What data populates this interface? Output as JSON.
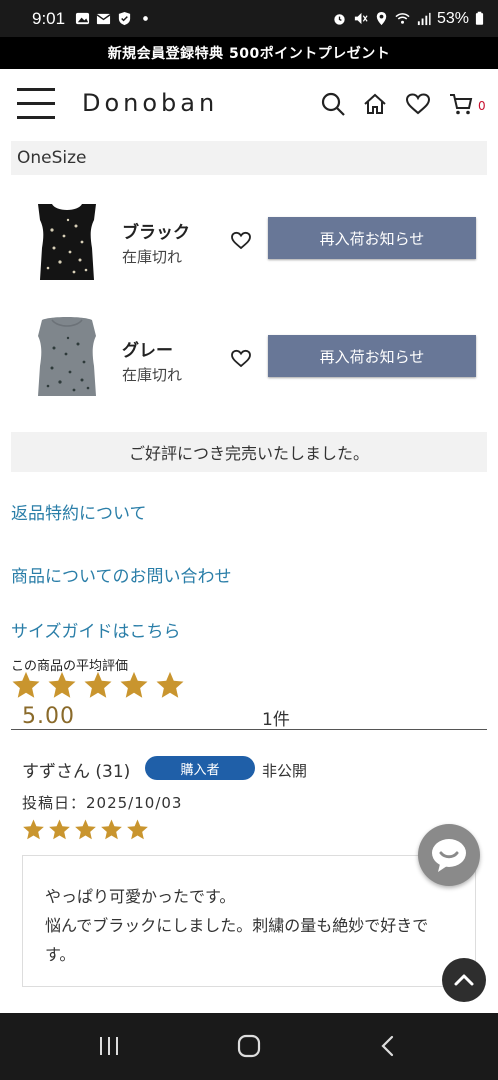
{
  "status_bar": {
    "time": "9:01",
    "battery": "53%"
  },
  "promo_banner": "新規会員登録特典 500ポイントプレゼント",
  "header": {
    "logo": "Donoban",
    "cart_count": "0"
  },
  "size_label": "OneSize",
  "variants": [
    {
      "color": "ブラック",
      "stock": "在庫切れ",
      "button": "再入荷お知らせ"
    },
    {
      "color": "グレー",
      "stock": "在庫切れ",
      "button": "再入荷お知らせ"
    }
  ],
  "sold_out_notice": "ご好評につき完売いたしました。",
  "links": {
    "returns": "返品特約について",
    "inquiry": "商品についてのお問い合わせ",
    "size_guide": "サイズガイドはこちら"
  },
  "rating": {
    "label": "この商品の平均評価",
    "average": "5.00",
    "stars": 5,
    "count": "1件"
  },
  "review": {
    "reviewer": "すずさん (31)",
    "badge": "購入者",
    "visibility": "非公開",
    "date": "投稿日：2025/10/03",
    "stars": 5,
    "text_line1": "やっぱり可愛かったです。",
    "text_line2": "悩んでブラックにしました。刺繍の量も絶妙で好きです。"
  },
  "colors": {
    "button_bg": "#687797",
    "link": "#2a7ea8",
    "star": "#c9952e",
    "badge": "#1f5fa8",
    "cart_badge": "#c8102e"
  },
  "icons": [
    "menu-icon",
    "search-icon",
    "home-icon",
    "heart-icon",
    "cart-icon",
    "chat-icon",
    "chevron-up-icon",
    "recents-icon",
    "home-nav-icon",
    "back-icon"
  ]
}
